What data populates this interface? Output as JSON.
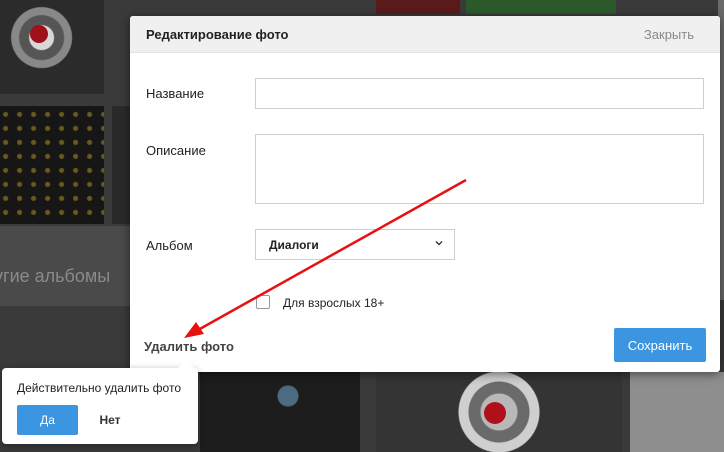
{
  "modal": {
    "title": "Редактирование фото",
    "close_label": "Закрыть",
    "fields": {
      "name_label": "Название",
      "name_value": "",
      "description_label": "Описание",
      "description_value": "",
      "album_label": "Альбом",
      "album_selected": "Диалоги"
    },
    "adult_checkbox_label": "Для взрослых 18+",
    "adult_checked": false,
    "delete_label": "Удалить фото",
    "save_label": "Сохранить"
  },
  "confirm": {
    "text": "Действительно удалить фото",
    "yes_label": "Да",
    "no_label": "Нет"
  },
  "background": {
    "albums_label": "угие альбомы"
  },
  "colors": {
    "accent": "#3b95e0",
    "annotation_arrow": "#e81010"
  },
  "icons": {
    "select_chevron": "chevron-down-icon"
  }
}
